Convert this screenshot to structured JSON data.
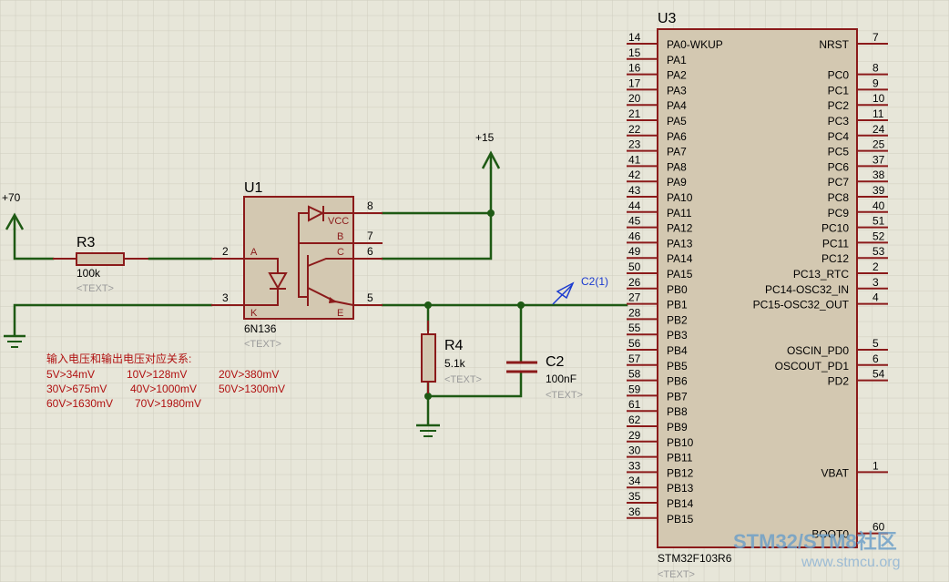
{
  "components": {
    "u1": {
      "ref": "U1",
      "part": "6N136",
      "text": "<TEXT>",
      "pins": {
        "p8": "8",
        "p7": "7",
        "p6": "6",
        "p5": "5",
        "p2": "2",
        "p3": "3"
      },
      "pin_labels": {
        "vcc": "VCC",
        "b": "B",
        "c": "C",
        "e": "E",
        "a": "A",
        "k": "K"
      }
    },
    "r3": {
      "ref": "R3",
      "value": "100k",
      "text": "<TEXT>"
    },
    "r4": {
      "ref": "R4",
      "value": "5.1k",
      "text": "<TEXT>"
    },
    "c2": {
      "ref": "C2",
      "value": "100nF",
      "text": "<TEXT>"
    },
    "u3": {
      "ref": "U3",
      "part": "STM32F103R6",
      "text": "<TEXT>",
      "left_pins": [
        {
          "num": "14",
          "name": "PA0-WKUP"
        },
        {
          "num": "15",
          "name": "PA1"
        },
        {
          "num": "16",
          "name": "PA2"
        },
        {
          "num": "17",
          "name": "PA3"
        },
        {
          "num": "20",
          "name": "PA4"
        },
        {
          "num": "21",
          "name": "PA5"
        },
        {
          "num": "22",
          "name": "PA6"
        },
        {
          "num": "23",
          "name": "PA7"
        },
        {
          "num": "41",
          "name": "PA8"
        },
        {
          "num": "42",
          "name": "PA9"
        },
        {
          "num": "43",
          "name": "PA10"
        },
        {
          "num": "44",
          "name": "PA11"
        },
        {
          "num": "45",
          "name": "PA12"
        },
        {
          "num": "46",
          "name": "PA13"
        },
        {
          "num": "49",
          "name": "PA14"
        },
        {
          "num": "50",
          "name": "PA15"
        },
        {
          "num": "26",
          "name": "PB0"
        },
        {
          "num": "27",
          "name": "PB1"
        },
        {
          "num": "28",
          "name": "PB2"
        },
        {
          "num": "55",
          "name": "PB3"
        },
        {
          "num": "56",
          "name": "PB4"
        },
        {
          "num": "57",
          "name": "PB5"
        },
        {
          "num": "58",
          "name": "PB6"
        },
        {
          "num": "59",
          "name": "PB7"
        },
        {
          "num": "61",
          "name": "PB8"
        },
        {
          "num": "62",
          "name": "PB9"
        },
        {
          "num": "29",
          "name": "PB10"
        },
        {
          "num": "30",
          "name": "PB11"
        },
        {
          "num": "33",
          "name": "PB12"
        },
        {
          "num": "34",
          "name": "PB13"
        },
        {
          "num": "35",
          "name": "PB14"
        },
        {
          "num": "36",
          "name": "PB15"
        }
      ],
      "right_pins": [
        {
          "num": "7",
          "name": "NRST"
        },
        {
          "num": "8",
          "name": "PC0"
        },
        {
          "num": "9",
          "name": "PC1"
        },
        {
          "num": "10",
          "name": "PC2"
        },
        {
          "num": "11",
          "name": "PC3"
        },
        {
          "num": "24",
          "name": "PC4"
        },
        {
          "num": "25",
          "name": "PC5"
        },
        {
          "num": "37",
          "name": "PC6"
        },
        {
          "num": "38",
          "name": "PC7"
        },
        {
          "num": "39",
          "name": "PC8"
        },
        {
          "num": "40",
          "name": "PC9"
        },
        {
          "num": "51",
          "name": "PC10"
        },
        {
          "num": "52",
          "name": "PC11"
        },
        {
          "num": "53",
          "name": "PC12"
        },
        {
          "num": "2",
          "name": "PC13_RTC"
        },
        {
          "num": "3",
          "name": "PC14-OSC32_IN"
        },
        {
          "num": "4",
          "name": "PC15-OSC32_OUT"
        },
        {
          "num": "5",
          "name": "OSCIN_PD0"
        },
        {
          "num": "6",
          "name": "OSCOUT_PD1"
        },
        {
          "num": "54",
          "name": "PD2"
        },
        {
          "num": "1",
          "name": "VBAT"
        },
        {
          "num": "60",
          "name": "BOOT0"
        }
      ]
    }
  },
  "power": {
    "p70": "+70",
    "p15": "+15"
  },
  "probe": {
    "label": "C2(1)"
  },
  "notes": {
    "title": "输入电压和输出电压对应关系:",
    "rows": [
      [
        "5V>34mV",
        "10V>128mV",
        "20V>380mV"
      ],
      [
        "30V>675mV",
        "40V>1000mV",
        "50V>1300mV"
      ],
      [
        "60V>1630mV",
        "70V>1980mV"
      ]
    ]
  },
  "watermark": {
    "brand": "STM32/STM8社区",
    "url": "www.stmcu.org"
  },
  "colors": {
    "background": "#e7e6d9",
    "wire": "#1e5a14",
    "component": "#8b1a1a",
    "body_fill": "#d3c8b1",
    "note": "#b01010",
    "probe": "#1a3ad0"
  }
}
